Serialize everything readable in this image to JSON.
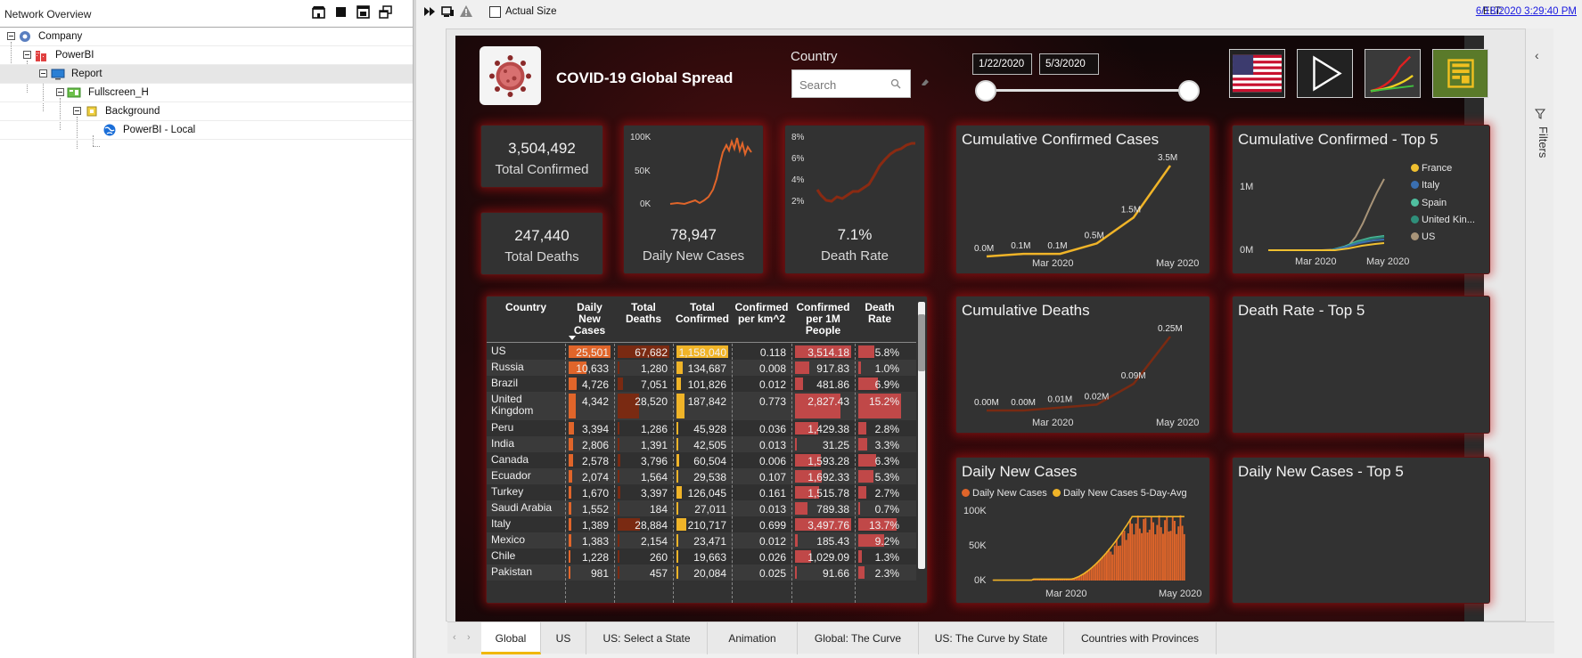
{
  "left_panel": {
    "title": "Network Overview",
    "tree": [
      {
        "label": "Company",
        "level": 0
      },
      {
        "label": "PowerBI",
        "level": 1
      },
      {
        "label": "Report",
        "level": 2,
        "selected": true
      },
      {
        "label": "Fullscreen_H",
        "level": 3
      },
      {
        "label": "Background",
        "level": 4
      },
      {
        "label": "PowerBI - Local",
        "level": 5
      }
    ]
  },
  "toolbar": {
    "actual_size_label": "Actual Size",
    "elt_label": "ELT:",
    "elt_value": "6/18/2020 3:29:40 PM"
  },
  "dashboard": {
    "title": "COVID-19 Global Spread",
    "country_label": "Country",
    "search_placeholder": "Search",
    "date_start": "1/22/2020",
    "date_end": "5/3/2020",
    "kpis": {
      "total_confirmed": {
        "value": "3,504,492",
        "label": "Total Confirmed"
      },
      "total_deaths": {
        "value": "247,440",
        "label": "Total Deaths"
      },
      "daily_new": {
        "value": "78,947",
        "label": "Daily New Cases"
      },
      "death_rate": {
        "value": "7.1%",
        "label": "Death Rate"
      }
    },
    "sparks": {
      "daily_ticks": [
        "100K",
        "50K",
        "0K"
      ],
      "rate_ticks": [
        "8%",
        "6%",
        "4%",
        "2%"
      ]
    },
    "cards": {
      "cum_confirmed": "Cumulative Confirmed Cases",
      "cum_top5": "Cumulative Confirmed - Top 5",
      "cum_deaths": "Cumulative Deaths",
      "death_rate_top5": "Death Rate - Top 5",
      "daily_new": "Daily New Cases",
      "daily_top5": "Daily New Cases - Top 5"
    },
    "table": {
      "headers": [
        "Country",
        "Daily New Cases",
        "Total Deaths",
        "Total Confirmed",
        "Confirmed per km^2",
        "Confirmed per 1M People",
        "Death Rate"
      ],
      "rows": [
        [
          "US",
          "25,501",
          "67,682",
          "1,158,040",
          "0.118",
          "3,514.18",
          "5.8%"
        ],
        [
          "Russia",
          "10,633",
          "1,280",
          "134,687",
          "0.008",
          "917.83",
          "1.0%"
        ],
        [
          "Brazil",
          "4,726",
          "7,051",
          "101,826",
          "0.012",
          "481.86",
          "6.9%"
        ],
        [
          "United Kingdom",
          "4,342",
          "28,520",
          "187,842",
          "0.773",
          "2,827.43",
          "15.2%"
        ],
        [
          "Peru",
          "3,394",
          "1,286",
          "45,928",
          "0.036",
          "1,429.38",
          "2.8%"
        ],
        [
          "India",
          "2,806",
          "1,391",
          "42,505",
          "0.013",
          "31.25",
          "3.3%"
        ],
        [
          "Canada",
          "2,578",
          "3,796",
          "60,504",
          "0.006",
          "1,593.28",
          "6.3%"
        ],
        [
          "Ecuador",
          "2,074",
          "1,564",
          "29,538",
          "0.107",
          "1,692.33",
          "5.3%"
        ],
        [
          "Turkey",
          "1,670",
          "3,397",
          "126,045",
          "0.161",
          "1,515.78",
          "2.7%"
        ],
        [
          "Saudi Arabia",
          "1,552",
          "184",
          "27,011",
          "0.013",
          "789.38",
          "0.7%"
        ],
        [
          "Italy",
          "1,389",
          "28,884",
          "210,717",
          "0.699",
          "3,497.76",
          "13.7%"
        ],
        [
          "Mexico",
          "1,383",
          "2,154",
          "23,471",
          "0.012",
          "185.43",
          "9.2%"
        ],
        [
          "Chile",
          "1,228",
          "260",
          "19,663",
          "0.026",
          "1,029.09",
          "1.3%"
        ],
        [
          "Pakistan",
          "981",
          "457",
          "20,084",
          "0.025",
          "91.66",
          "2.3%"
        ]
      ]
    },
    "colors": {
      "confirmed": "#f0b428",
      "deaths": "#7a2a12",
      "daily": "#e0652a",
      "death_rate": "#c04848",
      "glow": "#c81414"
    }
  },
  "chart_data": [
    {
      "type": "line",
      "title": "Cumulative Confirmed Cases",
      "x_ticks": [
        "Mar 2020",
        "May 2020"
      ],
      "series": [
        {
          "values": [
            0,
            0.1,
            0.1,
            0.5,
            1.5,
            3.5
          ]
        }
      ],
      "data_labels": [
        "0.0M",
        "0.1M",
        "0.1M",
        "0.5M",
        "1.5M",
        "3.5M"
      ]
    },
    {
      "type": "line",
      "title": "Cumulative Confirmed - Top 5",
      "y_ticks": [
        "1M",
        "0M"
      ],
      "x_ticks": [
        "Mar 2020",
        "May 2020"
      ],
      "legend": [
        "France",
        "Italy",
        "Spain",
        "United Kin...",
        "US"
      ],
      "legend_colors": [
        "#f0c030",
        "#3a6fb0",
        "#50c0a0",
        "#2f8f7a",
        "#a89478"
      ]
    },
    {
      "type": "line",
      "title": "Cumulative Deaths",
      "x_ticks": [
        "Mar 2020",
        "May 2020"
      ],
      "series": [
        {
          "values": [
            0,
            0,
            0.01,
            0.02,
            0.09,
            0.25
          ]
        }
      ],
      "data_labels": [
        "0.00M",
        "0.00M",
        "0.01M",
        "0.02M",
        "0.09M",
        "0.25M"
      ]
    },
    {
      "type": "bar",
      "title": "Daily New Cases",
      "legend": [
        "Daily New Cases",
        "Daily New Cases 5-Day-Avg"
      ],
      "y_ticks": [
        "100K",
        "50K",
        "0K"
      ],
      "x_ticks": [
        "Mar 2020",
        "May 2020"
      ]
    }
  ],
  "tabs": [
    "Global",
    "US",
    "US: Select a State",
    "Animation",
    "Global: The Curve",
    "US: The Curve by State",
    "Countries with Provinces"
  ],
  "filters_label": "Filters"
}
